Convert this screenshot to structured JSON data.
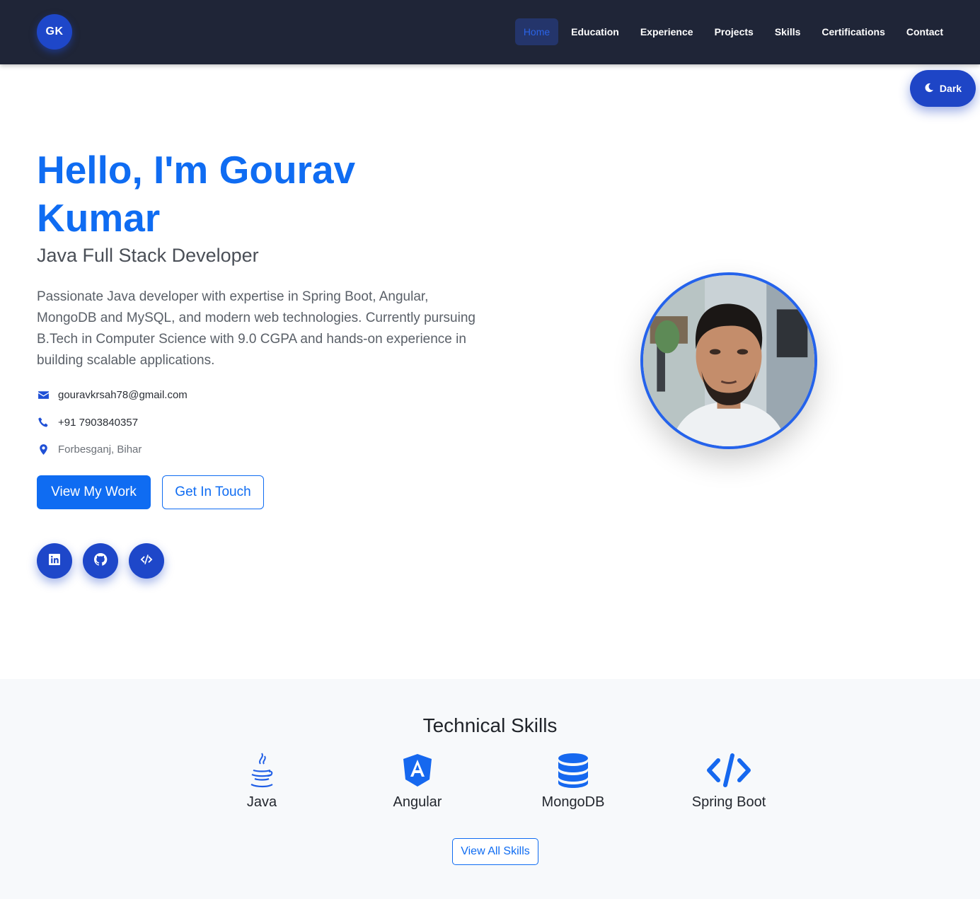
{
  "brand": {
    "logo_text": "GK"
  },
  "nav": {
    "items": [
      {
        "label": "Home"
      },
      {
        "label": "Education"
      },
      {
        "label": "Experience"
      },
      {
        "label": "Projects"
      },
      {
        "label": "Skills"
      },
      {
        "label": "Certifications"
      },
      {
        "label": "Contact"
      }
    ],
    "active": "Home"
  },
  "theme_toggle": {
    "label": "Dark",
    "icon": "moon-icon"
  },
  "hero": {
    "title": "Hello, I'm Gourav Kumar",
    "subtitle": "Java Full Stack Developer",
    "description": "Passionate Java developer with expertise in Spring Boot, Angular, MongoDB and MySQL, and modern web technologies. Currently pursuing B.Tech in Computer Science with 9.0 CGPA and hands-on experience in building scalable applications.",
    "contact": {
      "email": "gouravkrsah78@gmail.com",
      "phone": "+91 7903840357",
      "location": "Forbesganj, Bihar"
    },
    "buttons": {
      "primary": "View My Work",
      "secondary": "Get In Touch"
    },
    "social": [
      {
        "icon": "linkedin-icon"
      },
      {
        "icon": "github-icon"
      },
      {
        "icon": "code-icon"
      }
    ]
  },
  "skills": {
    "title": "Technical Skills",
    "items": [
      {
        "name": "Java",
        "icon": "java-icon"
      },
      {
        "name": "Angular",
        "icon": "angular-icon"
      },
      {
        "name": "MongoDB",
        "icon": "database-icon"
      },
      {
        "name": "Spring Boot",
        "icon": "code-icon"
      }
    ],
    "view_all": "View All Skills"
  },
  "colors": {
    "nav_bg": "#1f2537",
    "accent": "#0f6cf2",
    "button_blue": "#1e47c9",
    "skills_bg": "#f7f9fb"
  }
}
